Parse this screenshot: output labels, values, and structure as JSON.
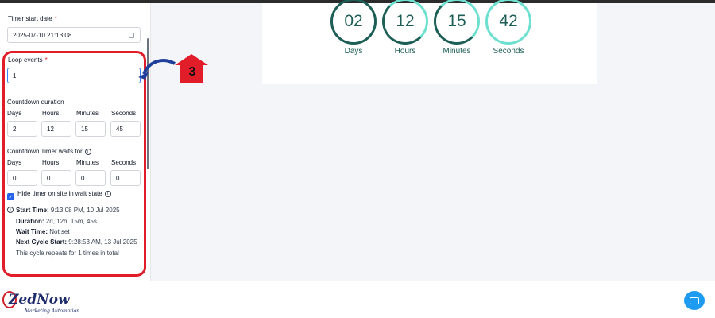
{
  "form": {
    "timer_start_date": {
      "label": "Timer start date",
      "required": "*",
      "value": "2025-07-10 21:13:08"
    },
    "loop_events": {
      "label": "Loop events",
      "required": "*",
      "value": "1"
    },
    "countdown_duration": {
      "title": "Countdown duration",
      "fields": [
        {
          "label": "Days",
          "value": "2"
        },
        {
          "label": "Hours",
          "value": "12"
        },
        {
          "label": "Minutes",
          "value": "15"
        },
        {
          "label": "Seconds",
          "value": "45"
        }
      ]
    },
    "wait": {
      "title": "Countdown Timer waits for",
      "fields": [
        {
          "label": "Days",
          "value": "0"
        },
        {
          "label": "Hours",
          "value": "0"
        },
        {
          "label": "Minutes",
          "value": "0"
        },
        {
          "label": "Seconds",
          "value": "0"
        }
      ]
    },
    "hide_timer": {
      "label": "Hide timer on site in wait state",
      "checked": true
    },
    "summary": {
      "start_label": "Start Time:",
      "start_value": "9:13:08 PM, 10 Jul 2025",
      "duration_label": "Duration:",
      "duration_value": "2d, 12h, 15m, 45s",
      "wait_label": "Wait Time:",
      "wait_value": "Not set",
      "next_label": "Next Cycle Start:",
      "next_value": "9:28:53 AM, 13 Jul 2025",
      "repeat_text": "This cycle repeats for 1 times in total"
    }
  },
  "annotation": {
    "step": "3"
  },
  "timer": {
    "units": [
      {
        "value": "02",
        "label": "Days"
      },
      {
        "value": "12",
        "label": "Hours"
      },
      {
        "value": "15",
        "label": "Minutes"
      },
      {
        "value": "42",
        "label": "Seconds"
      }
    ]
  },
  "logo": {
    "main": "ZedNow",
    "sub": "Marketing Automation"
  },
  "colors": {
    "accent_red": "#e11d2a",
    "timer_teal": "#1d5e56",
    "timer_light": "#6ee0d0",
    "focus_blue": "#3b82f6",
    "arrow_blue": "#1f3f9b"
  },
  "icons": {
    "chat": "chat-icon",
    "calendar": "calendar-icon",
    "info": "info-icon"
  }
}
